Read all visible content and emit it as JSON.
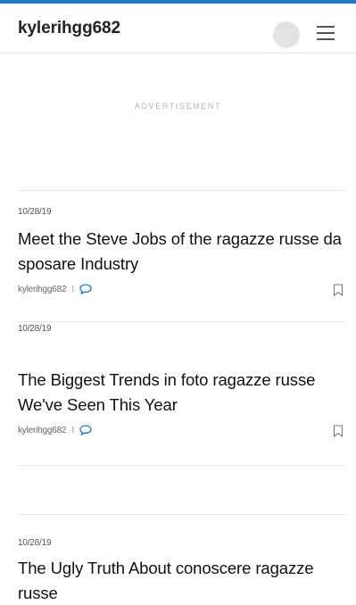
{
  "header": {
    "blog_name": "kylerihgg682"
  },
  "ad": {
    "label": "ADVERTISEMENT"
  },
  "posts": [
    {
      "date": "10/28/19",
      "title": "Meet the Steve Jobs of the ragazze russe da sposare Industry",
      "author": "kylerihgg682",
      "separator": "I"
    },
    {
      "date": "10/28/19",
      "title": "The Biggest Trends in foto ragazze russe We've Seen This Year",
      "author": "kylerihgg682",
      "separator": "I"
    },
    {
      "date": "10/28/19",
      "title": "The Ugly Truth About conoscere ragazze russe"
    }
  ],
  "icons": {
    "avatar": "avatar-circle",
    "menu": "hamburger-icon",
    "comment": "comment-bubble-icon",
    "bookmark": "bookmark-icon"
  },
  "colors": {
    "accent": "#1d78c6",
    "divider": "#e6e6e6",
    "avatar": "#e3e3e3"
  }
}
